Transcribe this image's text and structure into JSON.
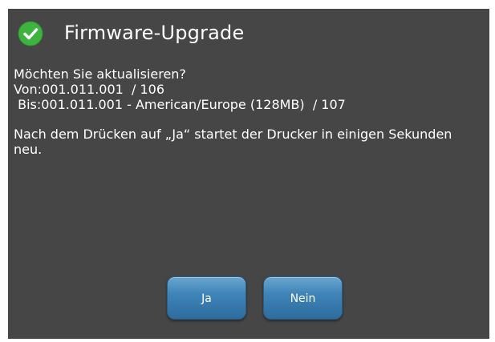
{
  "dialog": {
    "title": "Firmware-Upgrade",
    "title_icon": "check-circle-icon",
    "lines": [
      "Möchten Sie aktualisieren?",
      "Von:001.011.001  / 106",
      " Bis:001.011.001 - American/Europe (128MB)  / 107"
    ],
    "note": "Nach dem Drücken auf „Ja“ startet der Drucker in einigen Sekunden neu.",
    "yes_label": "Ja",
    "no_label": "Nein"
  },
  "colors": {
    "background": "#464646",
    "check_green": "#3fb33f",
    "button_blue": "#3f84b8"
  }
}
